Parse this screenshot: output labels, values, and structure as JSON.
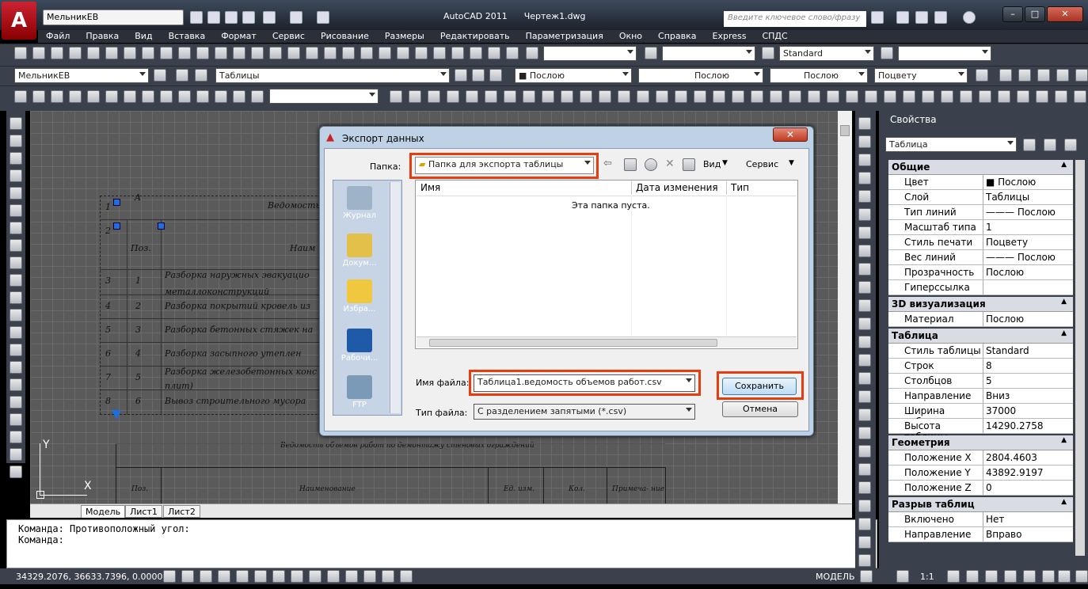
{
  "window": {
    "app_title": "AutoCAD 2011",
    "doc_title": "Чертеж1.dwg",
    "workspace": "МельникЕВ",
    "search_placeholder": "Введите ключевое слово/фразу",
    "logo_letter": "A"
  },
  "menu": [
    "Файл",
    "Правка",
    "Вид",
    "Вставка",
    "Формат",
    "Сервис",
    "Рисование",
    "Размеры",
    "Редактировать",
    "Параметризация",
    "Окно",
    "Справка",
    "Express",
    "СПДС"
  ],
  "toolbars": {
    "text_style": "Standard",
    "layer_state": "МельникЕВ",
    "layer": "Таблицы",
    "color": "Послою",
    "linetype": "Послою",
    "lineweight": "Послою",
    "plotstyle": "Поцвету"
  },
  "drawing": {
    "table_title": "Ведомость объемов",
    "col_num": "Поз.",
    "col_name": "Наим",
    "rows": [
      {
        "rn": "1",
        "n": "",
        "t": ""
      },
      {
        "rn": "2",
        "n": "",
        "t": ""
      },
      {
        "rn": "3",
        "n": "1",
        "t": "Разборка наружных эвакуацио"
      },
      {
        "rn": "4",
        "n": "2",
        "t": "Разборка покрытий кровель из"
      },
      {
        "rn": "5",
        "n": "3",
        "t": "Разборка бетонных стяжек на"
      },
      {
        "rn": "6",
        "n": "4",
        "t": "Разборка засыпного утеплен"
      },
      {
        "rn": "7",
        "n": "5",
        "t": "Разборка железобетонных конс"
      },
      {
        "rn": "8",
        "n": "6",
        "t": "Вывоз строительного мусора"
      }
    ],
    "row3_extra": "металлоконструкций",
    "row7_extra": "плит)",
    "col_a": "A",
    "bottom_title": "Ведомость объемов работ по демонтажу стеновых ограждений",
    "bottom_cols": [
      "Поз.",
      "Наименование",
      "Ед. изм.",
      "Кол.",
      "Примеча- ние"
    ],
    "ucs_x": "X",
    "ucs_y": "Y"
  },
  "tabs": [
    "Модель",
    "Лист1",
    "Лист2"
  ],
  "command": {
    "line1": "Команда: Противоположный угол:",
    "line2": "Команда:"
  },
  "status": {
    "coords": "34329.2076, 36633.7396, 0.0000",
    "model": "МОДЕЛЬ",
    "scale": "1:1"
  },
  "dialog": {
    "title": "Экспорт данных",
    "folder_label": "Папка:",
    "folder": "Папка для экспорта таблицы",
    "view_btn": "Вид",
    "tools_btn": "Сервис",
    "places": [
      "Журнал",
      "Докум...",
      "Избра...",
      "Рабочи...",
      "FTP"
    ],
    "col_name": "Имя",
    "col_date": "Дата изменения",
    "col_type": "Тип",
    "empty_msg": "Эта папка пуста.",
    "filename_label": "Имя файла:",
    "filename": "Таблица1.ведомость объемов работ.csv",
    "filetype_label": "Тип файла:",
    "filetype": "С разделением запятыми (*.csv)",
    "save": "Сохранить",
    "cancel": "Отмена"
  },
  "properties": {
    "title": "Свойства",
    "object": "Таблица",
    "sections": [
      {
        "name": "Общие",
        "rows": [
          [
            "Цвет",
            "■ Послою"
          ],
          [
            "Слой",
            "Таблицы"
          ],
          [
            "Тип линий",
            "——— Послою"
          ],
          [
            "Масштаб типа ...",
            "1"
          ],
          [
            "Стиль печати",
            "Поцвету"
          ],
          [
            "Вес линий",
            "——— Послою"
          ],
          [
            "Прозрачность",
            "Послою"
          ],
          [
            "Гиперссылка",
            ""
          ]
        ]
      },
      {
        "name": "3D визуализация",
        "rows": [
          [
            "Материал",
            "Послою"
          ]
        ]
      },
      {
        "name": "Таблица",
        "rows": [
          [
            "Стиль таблицы",
            "Standard"
          ],
          [
            "Строк",
            "8"
          ],
          [
            "Столбцов",
            "5"
          ],
          [
            "Направление",
            "Вниз"
          ],
          [
            "Ширина таблицы",
            "37000"
          ],
          [
            "Высота таблицы",
            "14290.2758"
          ]
        ]
      },
      {
        "name": "Геометрия",
        "rows": [
          [
            "Положение X",
            "2804.4603"
          ],
          [
            "Положение Y",
            "43892.9197"
          ],
          [
            "Положение Z",
            "0"
          ]
        ]
      },
      {
        "name": "Разрыв таблиц",
        "rows": [
          [
            "Включено",
            "Нет"
          ],
          [
            "Направление",
            "Вправо"
          ]
        ]
      }
    ]
  }
}
